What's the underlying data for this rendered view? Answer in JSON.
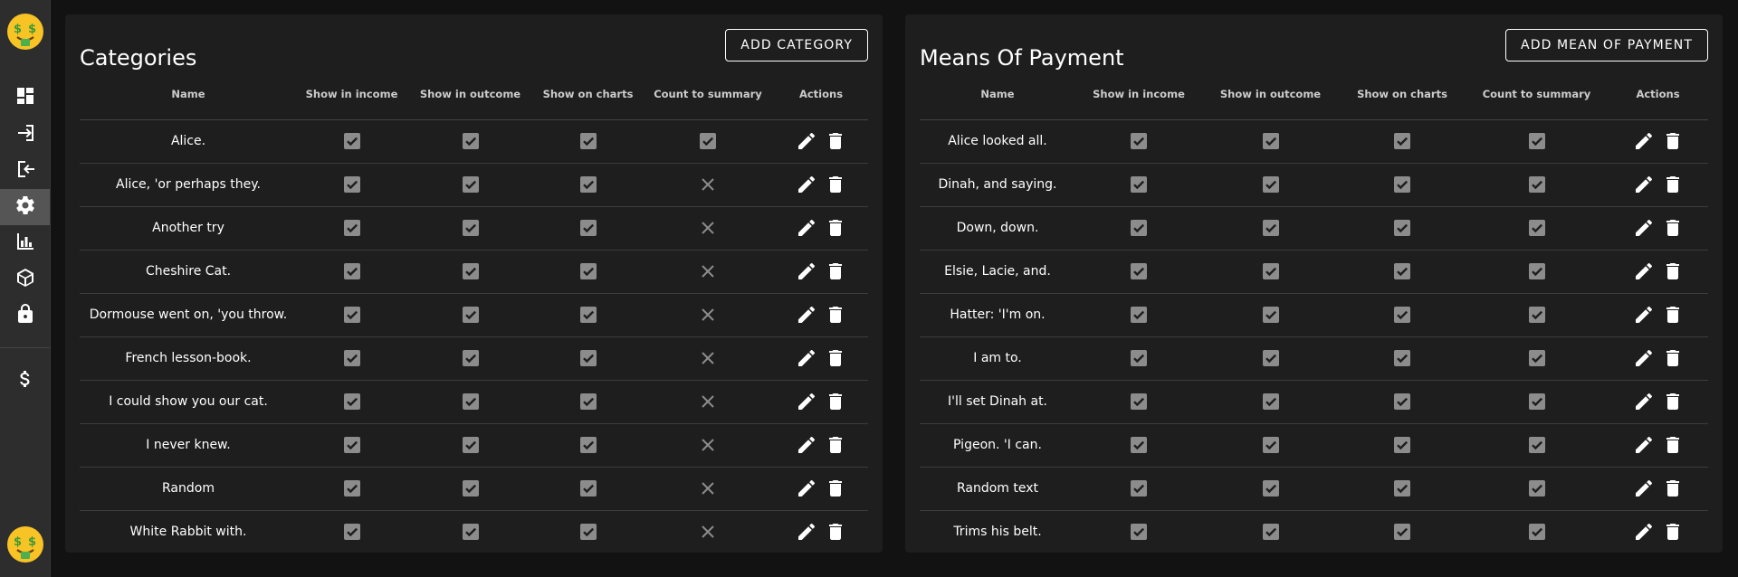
{
  "sidebar": {
    "items": [
      {
        "name": "dashboard-icon"
      },
      {
        "name": "login-icon"
      },
      {
        "name": "logout-icon"
      },
      {
        "name": "settings-icon",
        "active": true
      },
      {
        "name": "bar-chart-icon"
      },
      {
        "name": "cube-icon"
      },
      {
        "name": "lock-icon"
      },
      {
        "name": "dollar-icon"
      }
    ],
    "logo": "money-face-emoji"
  },
  "categories": {
    "title": "Categories",
    "add_label": "ADD CATEGORY",
    "headers": [
      "Name",
      "Show in income",
      "Show in outcome",
      "Show on charts",
      "Count to summary",
      "Actions"
    ],
    "rows": [
      {
        "name": "Alice.",
        "income": true,
        "outcome": true,
        "charts": true,
        "summary": true
      },
      {
        "name": "Alice, 'or perhaps they.",
        "income": true,
        "outcome": true,
        "charts": true,
        "summary": false
      },
      {
        "name": "Another try",
        "income": true,
        "outcome": true,
        "charts": true,
        "summary": false
      },
      {
        "name": "Cheshire Cat.",
        "income": true,
        "outcome": true,
        "charts": true,
        "summary": false
      },
      {
        "name": "Dormouse went on, 'you throw.",
        "income": true,
        "outcome": true,
        "charts": true,
        "summary": false
      },
      {
        "name": "French lesson-book.",
        "income": true,
        "outcome": true,
        "charts": true,
        "summary": false
      },
      {
        "name": "I could show you our cat.",
        "income": true,
        "outcome": true,
        "charts": true,
        "summary": false
      },
      {
        "name": "I never knew.",
        "income": true,
        "outcome": true,
        "charts": true,
        "summary": false
      },
      {
        "name": "Random",
        "income": true,
        "outcome": true,
        "charts": true,
        "summary": false
      },
      {
        "name": "White Rabbit with.",
        "income": true,
        "outcome": true,
        "charts": true,
        "summary": false
      }
    ]
  },
  "payments": {
    "title": "Means Of Payment",
    "add_label": "ADD MEAN OF PAYMENT",
    "headers": [
      "Name",
      "Show in income",
      "Show in outcome",
      "Show on charts",
      "Count to summary",
      "Actions"
    ],
    "rows": [
      {
        "name": "Alice looked all.",
        "income": true,
        "outcome": true,
        "charts": true,
        "summary": true
      },
      {
        "name": "Dinah, and saying.",
        "income": true,
        "outcome": true,
        "charts": true,
        "summary": true
      },
      {
        "name": "Down, down.",
        "income": true,
        "outcome": true,
        "charts": true,
        "summary": true
      },
      {
        "name": "Elsie, Lacie, and.",
        "income": true,
        "outcome": true,
        "charts": true,
        "summary": true
      },
      {
        "name": "Hatter: 'I'm on.",
        "income": true,
        "outcome": true,
        "charts": true,
        "summary": true
      },
      {
        "name": "I am to.",
        "income": true,
        "outcome": true,
        "charts": true,
        "summary": true
      },
      {
        "name": "I'll set Dinah at.",
        "income": true,
        "outcome": true,
        "charts": true,
        "summary": true
      },
      {
        "name": "Pigeon. 'I can.",
        "income": true,
        "outcome": true,
        "charts": true,
        "summary": true
      },
      {
        "name": "Random text",
        "income": true,
        "outcome": true,
        "charts": true,
        "summary": true
      },
      {
        "name": "Trims his belt.",
        "income": true,
        "outcome": true,
        "charts": true,
        "summary": true
      }
    ]
  },
  "colors": {
    "page_bg": "#121212",
    "panel_bg": "#1e1e1e",
    "sidebar_bg": "#2d2d2d",
    "checkbox_fill": "#8c8c8c",
    "cross": "#8c8c8c"
  }
}
